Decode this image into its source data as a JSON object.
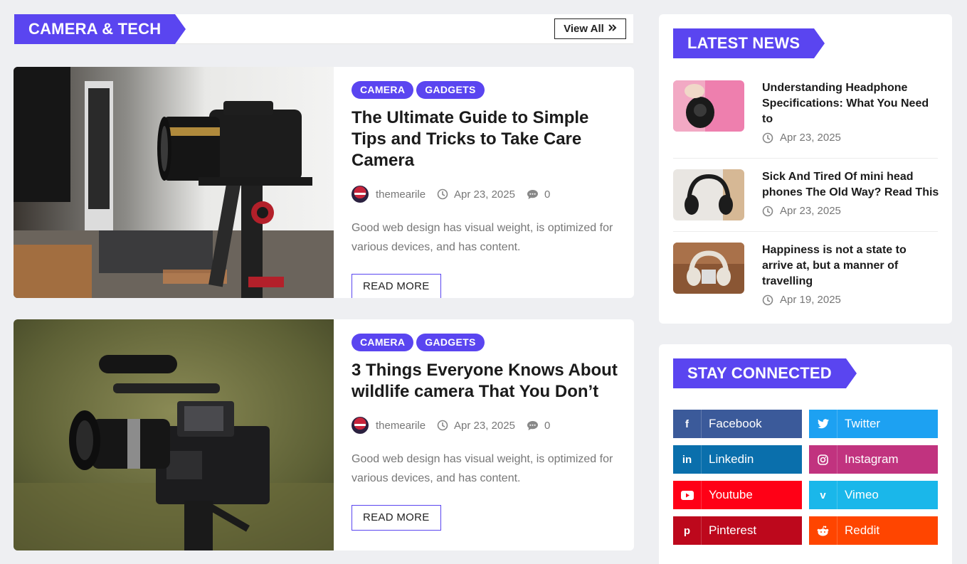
{
  "section": {
    "title": "CAMERA & TECH",
    "view_all": "View All"
  },
  "posts": [
    {
      "categories": [
        "CAMERA",
        "GADGETS"
      ],
      "title": "The Ultimate Guide to Simple Tips and Tricks to Take Care Camera",
      "author": "themearile",
      "date": "Apr 23, 2025",
      "comments": "0",
      "excerpt": "Good web design has visual weight, is optimized for various devices, and has content.",
      "read_more": "READ MORE"
    },
    {
      "categories": [
        "CAMERA",
        "GADGETS"
      ],
      "title": "3 Things Everyone Knows About wildlife camera That You Don’t",
      "author": "themearile",
      "date": "Apr 23, 2025",
      "comments": "0",
      "excerpt": "Good web design has visual weight, is optimized for various devices, and has content.",
      "read_more": "READ MORE"
    }
  ],
  "latest_news": {
    "title": "LATEST NEWS",
    "items": [
      {
        "title": "Understanding Headphone Specifications: What You Need to",
        "date": "Apr 23, 2025"
      },
      {
        "title": "Sick And Tired Of mini head phones The Old Way? Read This",
        "date": "Apr 23, 2025"
      },
      {
        "title": "Happiness is not a state to arrive at, but a manner of travelling",
        "date": "Apr 19, 2025"
      }
    ]
  },
  "stay_connected": {
    "title": "STAY CONNECTED",
    "links": [
      {
        "label": "Facebook",
        "icon": "facebook-icon",
        "color": "#3b5a9a"
      },
      {
        "label": "Twitter",
        "icon": "twitter-icon",
        "color": "#1da1f2"
      },
      {
        "label": "Linkedin",
        "icon": "linkedin-icon",
        "color": "#0a6fac"
      },
      {
        "label": "Instagram",
        "icon": "instagram-icon",
        "color": "#c1337f"
      },
      {
        "label": "Youtube",
        "icon": "youtube-icon",
        "color": "#ff0016"
      },
      {
        "label": "Vimeo",
        "icon": "vimeo-icon",
        "color": "#1ab7ea"
      },
      {
        "label": "Pinterest",
        "icon": "pinterest-icon",
        "color": "#bd081c"
      },
      {
        "label": "Reddit",
        "icon": "reddit-icon",
        "color": "#ff4500"
      }
    ]
  },
  "colors": {
    "accent": "#5a45f0",
    "background": "#eeeff2"
  }
}
